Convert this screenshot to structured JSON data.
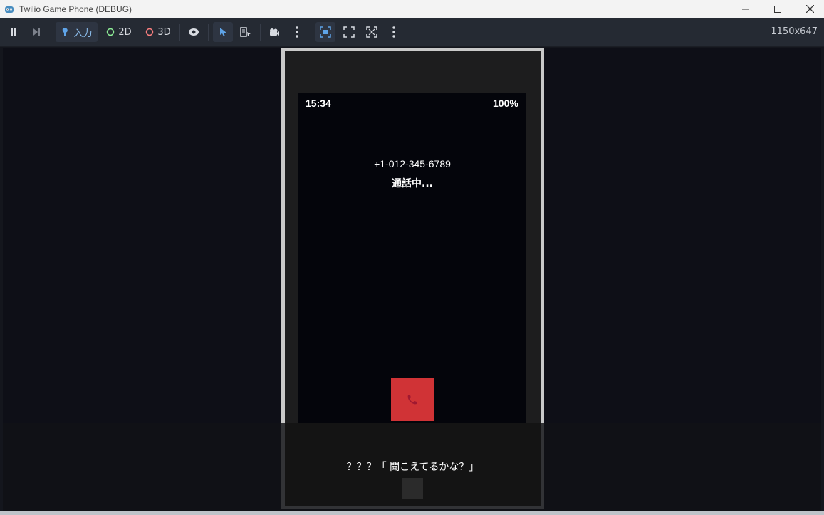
{
  "window": {
    "title": "Twilio Game Phone (DEBUG)"
  },
  "toolbar": {
    "input_label": "入力",
    "mode_2d_label": "2D",
    "mode_3d_label": "3D",
    "resolution": "1150x647"
  },
  "phone": {
    "time": "15:34",
    "battery": "100%",
    "number": "+1-012-345-6789",
    "call_status": "通話中..."
  },
  "dialog": {
    "text": "？？？「 聞こえてるかな？」"
  },
  "colors": {
    "hangup": "#d03336",
    "toolbar_bg": "#252a33",
    "viewport_bg": "#0e0f17"
  }
}
